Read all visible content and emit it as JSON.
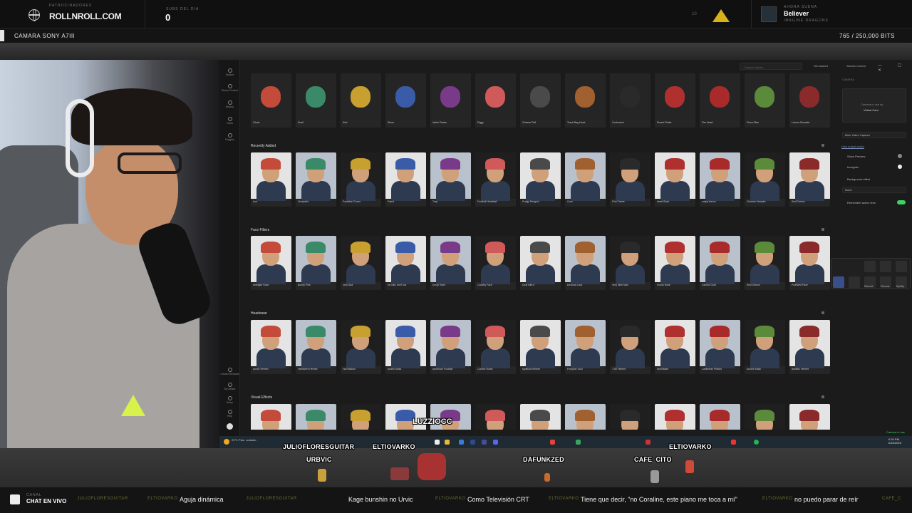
{
  "overlay": {
    "sponsor_label": "PATROCINADORES",
    "sponsor_name": "ROLLNROLL.COM",
    "subs_label": "SUBS DEL DIA",
    "subs_value": "0",
    "subs_goal": "10",
    "now_playing_label": "AHORA SUENA",
    "now_playing_song": "Believer",
    "now_playing_artist": "IMAGINE DRAGONS",
    "camera_label": "CAMARA SONY A7III",
    "bits_label": "765 / 250,000 BITS"
  },
  "app": {
    "sidebar": [
      {
        "label": "Explore"
      },
      {
        "label": "Stream Control"
      },
      {
        "label": "Beauty"
      },
      {
        "label": "Clubs"
      },
      {
        "label": "Friggers"
      }
    ],
    "sidebar_bottom": [
      {
        "label": "Creator Rewards"
      },
      {
        "label": "My details"
      },
      {
        "label": "Setup"
      },
      {
        "label": "Help"
      }
    ],
    "search_placeholder": "Search shouts...",
    "get_started": "Get started",
    "stream_control": "Stream Control",
    "window_controls": "— ▢ ✕",
    "top_row": [
      "Ghost",
      "Snail",
      "Kiwi",
      "Stone",
      "Idaho Potato",
      "Piggy",
      "Cheese Puff",
      "Trash Bag Head",
      "Cockroach",
      "Round Pirate",
      "Fire Head",
      "Pizza Slice",
      "Lemon Grenade"
    ],
    "sections": [
      {
        "title": "Recently Added",
        "items": [
          "Ace",
          "Cleopatra",
          "Paradise Crown",
          "Patrol",
          "Trap",
          "Football Headball",
          "Pudgy Penguin",
          "Orno",
          "Film Frame",
          "Heart Eyes",
          "crispy bacon",
          "Chinese Vampire",
          "Red Demon"
        ]
      },
      {
        "title": "Face Filters",
        "items": [
          "Midnight Rose",
          "Bunny Pink",
          "Very Sad",
          "No hair, don't car",
          "Emoji Team",
          "Chubby Face",
          "Deal with it",
          "Devious Look",
          "Very Nice Man",
          "Funny Nose",
          "Old but Gold",
          "Red Demon",
          "Pixelized Face"
        ]
      },
      {
        "title": "Headwear",
        "items": [
          "Armor Helmet",
          "Helldivers Helmet",
          "Hat Balloon",
          "Arabic Mask",
          "American Football",
          "Cursed Nurse",
          "Mystical Helmet",
          "Pumpkin Soul",
          "T-60 Helmet",
          "Wolvblade",
          "Caribbean Pirates",
          "Anubis Mask",
          "Ballistic Helmet"
        ]
      },
      {
        "title": "Visual Effects",
        "items": [
          "",
          "",
          "",
          "",
          "",
          "",
          "",
          "",
          "",
          "",
          "",
          "",
          ""
        ]
      }
    ],
    "right_panel": {
      "camera_header": "CAMERA",
      "camera_in_use": "Camera in use by",
      "virtual_cam": "Virtual Cam",
      "how_output": "How output works",
      "source": "filme Video Capture",
      "show_preview": "Show Preview",
      "incognito": "Incognito",
      "background_effect": "Background effect",
      "background_value": "None",
      "remember_lens": "Remember active lens",
      "mini_labels": [
        "Discord",
        "Chrome",
        "Spotify"
      ]
    },
    "camera_status": "Camera in use",
    "taskbar": {
      "weather": "23°C Parc. soleado",
      "time": "6:34 PM",
      "date": "6/18/2025"
    }
  },
  "overlay_bottom": {
    "luzzio": "LUZZIOCC",
    "viewers": [
      "JULIOFLORESGUITAR",
      "ELTIOVARKO",
      "URBVIC",
      "DAFUNKZED",
      "CAFE_CITO",
      "ELTIOVARKO"
    ],
    "chat_small": "CANAL",
    "chat_live": "CHAT EN VIVO",
    "ticker": [
      {
        "user": "JULIOFLORESGUITAR",
        "msg": ""
      },
      {
        "user": "ELTIOVARKO",
        "msg": "Aguja dinámica"
      },
      {
        "user": "JULIOFLORESGUITAR",
        "msg": "Kage bunshin no Urvic"
      },
      {
        "user": "ELTIOVARKO",
        "msg": "Como Televisión CRT"
      },
      {
        "user": "ELTIOVARKO",
        "msg": "Tiene que decir, \"no Coraline, este piano me toca a mí\""
      },
      {
        "user": "ELTIOVARKO",
        "msg": "no puedo parar de reír"
      },
      {
        "user": "CAFE_C",
        "msg": ""
      }
    ]
  },
  "colors": {
    "accent_green": "#3bd266",
    "triforce": "#d8b21a"
  }
}
